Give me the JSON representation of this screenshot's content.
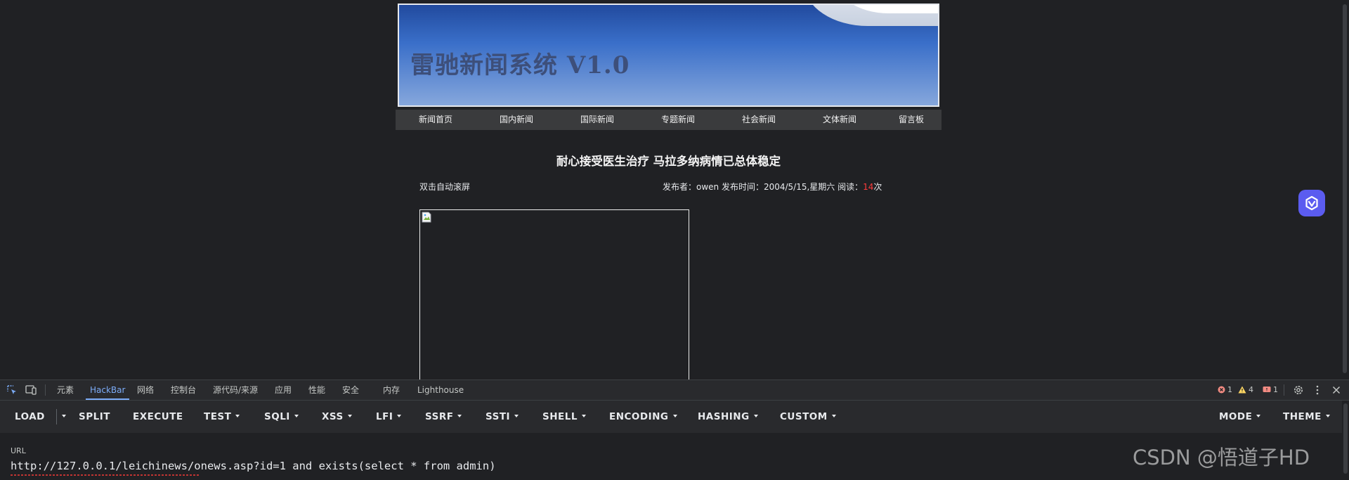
{
  "site": {
    "banner_title": "雷驰新闻系统 V1.0",
    "nav": [
      "新闻首页",
      "国内新闻",
      "国际新闻",
      "专题新闻",
      "社会新闻",
      "文体新闻",
      "留言板"
    ],
    "article": {
      "title": "耐心接受医生治疗 马拉多纳病情已总体稳定",
      "autoscroll_label": "双击自动滚屏",
      "meta_prefix": "发布者：owen 发布时间：2004/5/15,星期六 阅读：",
      "read_count": "14",
      "read_suffix": "次"
    }
  },
  "devtools": {
    "tabs": [
      "元素",
      "HackBar",
      "网络",
      "控制台",
      "源代码/来源",
      "应用",
      "性能",
      "安全",
      "内存",
      "Lighthouse"
    ],
    "active_tab": "HackBar",
    "issues": {
      "errors": "1",
      "warnings": "4",
      "info": "1"
    },
    "colors": {
      "accent": "#7cacf8",
      "error": "#f28b82",
      "warning": "#fdd663"
    }
  },
  "hackbar": {
    "buttons": [
      "LOAD",
      "SPLIT",
      "EXECUTE",
      "TEST",
      "SQLI",
      "XSS",
      "LFI",
      "SSRF",
      "SSTI",
      "SHELL",
      "ENCODING",
      "HASHING",
      "CUSTOM"
    ],
    "right_buttons": [
      "MODE",
      "THEME"
    ],
    "url_label": "URL",
    "url_value": "http://127.0.0.1/leichinews/onews.asp?id=1 and exists(select * from admin)"
  },
  "watermark": "CSDN @悟道子HD"
}
